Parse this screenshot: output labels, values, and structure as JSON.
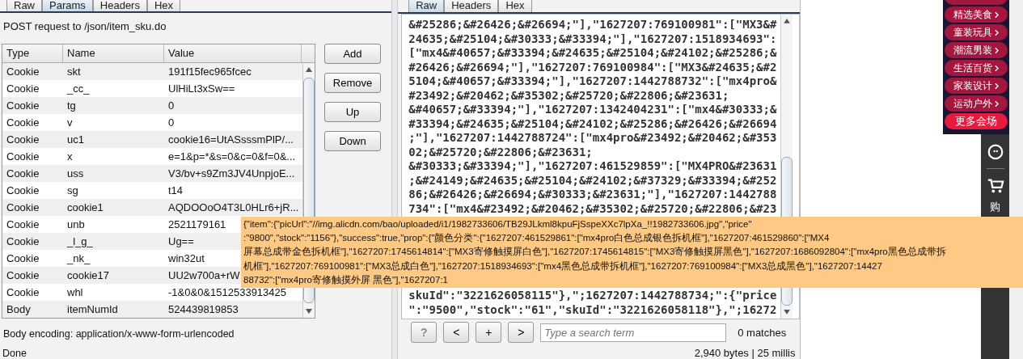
{
  "request_panel": {
    "tabs": [
      {
        "label": "Raw",
        "selected": false
      },
      {
        "label": "Params",
        "selected": true
      },
      {
        "label": "Headers",
        "selected": false
      },
      {
        "label": "Hex",
        "selected": false
      }
    ],
    "heading": "POST request to /json/item_sku.do",
    "table": {
      "columns": [
        "Type",
        "Name",
        "Value"
      ],
      "rows": [
        {
          "type": "Cookie",
          "name": "skt",
          "value": "191f15fec965fcec"
        },
        {
          "type": "Cookie",
          "name": "_cc_",
          "value": "UlHiLt3xSw=="
        },
        {
          "type": "Cookie",
          "name": "tg",
          "value": "0"
        },
        {
          "type": "Cookie",
          "name": "v",
          "value": "0"
        },
        {
          "type": "Cookie",
          "name": "uc1",
          "value": "cookie16=UtASsssmPlP/..."
        },
        {
          "type": "Cookie",
          "name": "x",
          "value": "e=1&p=*&s=0&c=0&f=0&..."
        },
        {
          "type": "Cookie",
          "name": "uss",
          "value": "V3/bv+s9Zm3JV4UnpjoE..."
        },
        {
          "type": "Cookie",
          "name": "sg",
          "value": "t14"
        },
        {
          "type": "Cookie",
          "name": "cookie1",
          "value": "AQDOOoO4T3L0HLr6+jR..."
        },
        {
          "type": "Cookie",
          "name": "unb",
          "value": "2521179161"
        },
        {
          "type": "Cookie",
          "name": "_l_g_",
          "value": "Ug=="
        },
        {
          "type": "Cookie",
          "name": "_nk_",
          "value": "win32ut"
        },
        {
          "type": "Cookie",
          "name": "cookie17",
          "value": "UU2w700a+rW"
        },
        {
          "type": "Cookie",
          "name": "whl",
          "value": "-1&0&0&1512533913425"
        },
        {
          "type": "Body",
          "name": "itemNumId",
          "value": "524439819853"
        }
      ]
    },
    "buttons": [
      "Add",
      "Remove",
      "Up",
      "Down"
    ],
    "encoding": "Body encoding: application/x-www-form-urlencoded",
    "status": "Done"
  },
  "response_panel": {
    "tabs": [
      {
        "label": "Raw",
        "selected": true
      },
      {
        "label": "Headers",
        "selected": false
      },
      {
        "label": "Hex",
        "selected": false
      }
    ],
    "raw_lines_top": [
      "&#25286;&#26426;&#26694;\"],\"1627207:769100981\":[\"MX3&#",
      "24635;&#25104;&#30333;&#33394;\"],\"1627207:1518934693\":",
      "[\"mx4&#40657;&#33394;&#24635;&#25104;&#24102;&#25286;&",
      "#26426;&#26694;\"],\"1627207:769100984\":[\"MX3&#24635;&#2",
      "5104;&#40657;&#33394;\"],\"1627207:1442788732\":[\"mx4pro&",
      "#23492;&#20462;&#35302;&#25720;&#22806;&#23631;",
      "&#40657;&#33394;\"],\"1627207:1342404231\":[\"mx4&#30333;&",
      "#33394;&#24635;&#25104;&#24102;&#25286;&#26426;&#26694",
      ";\"],\"1627207:1442788724\":[\"mx4pro&#23492;&#20462;&#353",
      "02;&#25720;&#22806;&#23631;",
      "&#30333;&#33394;\"],\"1627207:461529859\":[\"MX4PRO&#23631",
      ";&#24149;&#24635;&#25104;&#24102;&#37329;&#33394;&#252",
      "86;&#26426;&#26694;&#30333;&#23631;\"],\"1627207:1442788",
      "734\":[\"mx4&#23492;&#20462;&#35302;&#25720;&#22806;&#23"
    ],
    "raw_lines_bottom": [
      "skuId\":\"3221626058115\"},\";1627207:1442788734;\":{\"price",
      "\":\"9500\",\"stock\":\"61\",\"skuId\":\"3221626058118\"},\";16272"
    ],
    "search_buttons": [
      "?",
      "<",
      "+",
      ">"
    ],
    "search": {
      "placeholder": "Type a search term"
    },
    "matches": "0 matches",
    "status": "2,940 bytes | 25 millis"
  },
  "tooltip": {
    "lines": [
      "{\"item\":{\"picUrl\":\"//img.alicdn.com/bao/uploaded/i1/1982733606/TB29JLkml8kpuFjSspeXXc7lpXa_!!1982733606.jpg\",\"price\"",
      ":\"9800\",\"stock\":\"1156\"},\"success\":true,\"prop\":{\"颜色分类\":{\"1627207:461529861\":[\"mx4pro白色总成银色拆机框\"],\"1627207:461529860\":[\"MX4",
      "屏幕总成带金色拆机框\"],\"1627207:1745614814\":[\"MX3寄修触摸屏白色\"],\"1627207:1745614815\":[\"MX3寄修触摸屏黑色\"],\"1627207:1686092804\":[\"mx4pro黑色总成带拆",
      "机框\"],\"1627207:769100981\":[\"MX3总成白色\"],\"1627207:1518934693\":[\"mx4黑色总成带拆机框\"],\"1627207:769100984\":[\"MX3总成黑色\"],\"1627207:14427",
      "88732\":[\"mx4pro寄修触摸外屏 黑色\"],\"1627207:1"
    ]
  },
  "web_sidebar": {
    "categories": [
      {
        "label": "精选美食",
        "kind": "category"
      },
      {
        "label": "童装玩具",
        "kind": "category"
      },
      {
        "label": "潮流男装",
        "kind": "category"
      },
      {
        "label": "生活百货",
        "kind": "category"
      },
      {
        "label": "家装设计",
        "kind": "category"
      },
      {
        "label": "运动户外",
        "kind": "category"
      },
      {
        "label": "更多会场",
        "kind": "more"
      }
    ],
    "cart_label": "购"
  }
}
